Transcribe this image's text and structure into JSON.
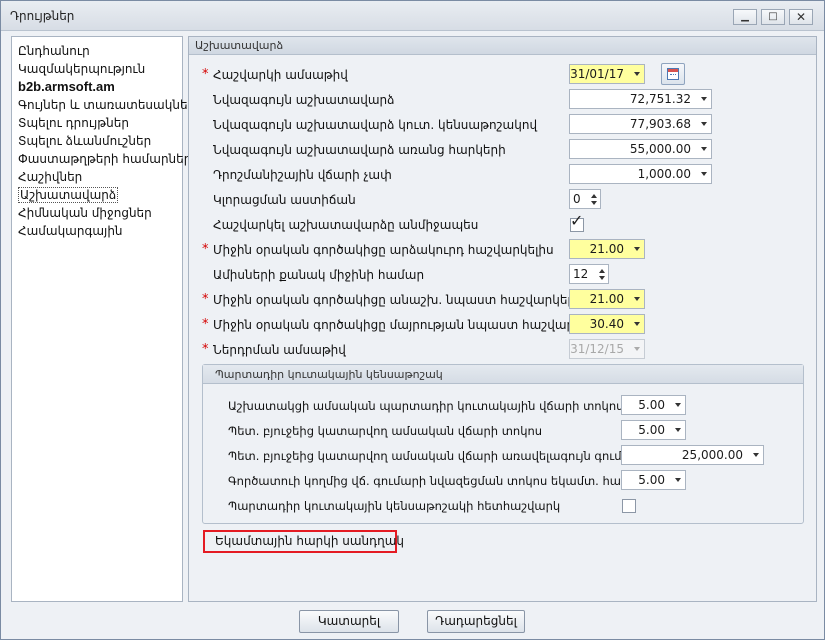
{
  "window": {
    "title": "Դրույթներ"
  },
  "sidebar": {
    "items": [
      {
        "label": "Ընդհանուր"
      },
      {
        "label": "Կազմակերպություն"
      },
      {
        "label": "b2b.armsoft.am"
      },
      {
        "label": "Գույներ և տառատեսակներ"
      },
      {
        "label": "Տպելու դրույթներ"
      },
      {
        "label": "Տպելու ձևանմուշներ"
      },
      {
        "label": "Փաստաթղթերի համարներ"
      },
      {
        "label": "Հաշիվներ"
      },
      {
        "label": "Աշխատավարձ"
      },
      {
        "label": "Հիմնական միջոցներ"
      },
      {
        "label": "Համակարգային"
      }
    ],
    "selected": "Աշխատավարձ"
  },
  "main": {
    "header": "Աշխատավարձ",
    "fields": {
      "calc_date": {
        "label": "Հաշվարկի ամսաթիվ",
        "value": "31/01/17",
        "required": true
      },
      "min_salary": {
        "label": "Նվազագույն աշխատավարձ",
        "value": "72,751.32"
      },
      "min_salary_pension": {
        "label": "Նվազագույն աշխատավարձ կուտ. կենսաթոշակով",
        "value": "77,903.68"
      },
      "min_salary_no_tax": {
        "label": "Նվազագույն աշխատավարձ առանց հարկերի",
        "value": "55,000.00"
      },
      "stamp_fee": {
        "label": "Դրոշմանիշային վճարի չափ",
        "value": "1,000.00"
      },
      "rounding": {
        "label": "Կլորացման աստիճան",
        "value": "0"
      },
      "calc_immediately": {
        "label": "Հաշվարկել աշխատավարձը անմիջապես",
        "checked": true
      },
      "avg_daily_vacation": {
        "label": "Միջին օրական գործակիցը արձակուրդ հաշվարկելիս",
        "value": "21.00",
        "required": true
      },
      "months_count": {
        "label": "Ամիսների քանակ միջինի համար",
        "value": "12"
      },
      "avg_daily_sick": {
        "label": "Միջին օրական գործակիցը անաշխ. նպաստ հաշվարկելիս",
        "value": "21.00",
        "required": true
      },
      "avg_daily_maternity": {
        "label": "Միջին օրական գործակիցը մայրության նպաստ հաշվարկելիս",
        "value": "30.40",
        "required": true
      },
      "import_date": {
        "label": "Ներդրման ամսաթիվ",
        "value": "31/12/15",
        "required": true
      }
    },
    "pension_group": {
      "header": "Պարտադիր կուտակային կենսաթոշակ",
      "employee_rate": {
        "label": "Աշխատակցի ամսական պարտադիր կուտակային վճարի տոկոս",
        "value": "5.00"
      },
      "state_rate": {
        "label": "Պետ. բյուջեից կատարվող ամսական վճարի տոկոս",
        "value": "5.00"
      },
      "state_cap": {
        "label": "Պետ. բյուջեից կատարվող ամսական վճարի առավելագույն գումար",
        "value": "25,000.00"
      },
      "employer_rate": {
        "label": "Գործատուի կողմից վճ. գումարի նվազեցման տոկոս եկամտ. հարկից",
        "value": "5.00"
      },
      "monitoring": {
        "label": "Պարտադիր կուտակային կենսաթոշակի հետհաշվարկ",
        "checked": false
      }
    },
    "income_tax_scale": "Եկամտային հարկի սանդղակ"
  },
  "buttons": {
    "ok": "Կատարել",
    "cancel": "Դադարեցնել"
  },
  "colors": {
    "required_star": "#d40000",
    "highlight_field": "#ffff9e",
    "red_outline": "#e41b23"
  }
}
